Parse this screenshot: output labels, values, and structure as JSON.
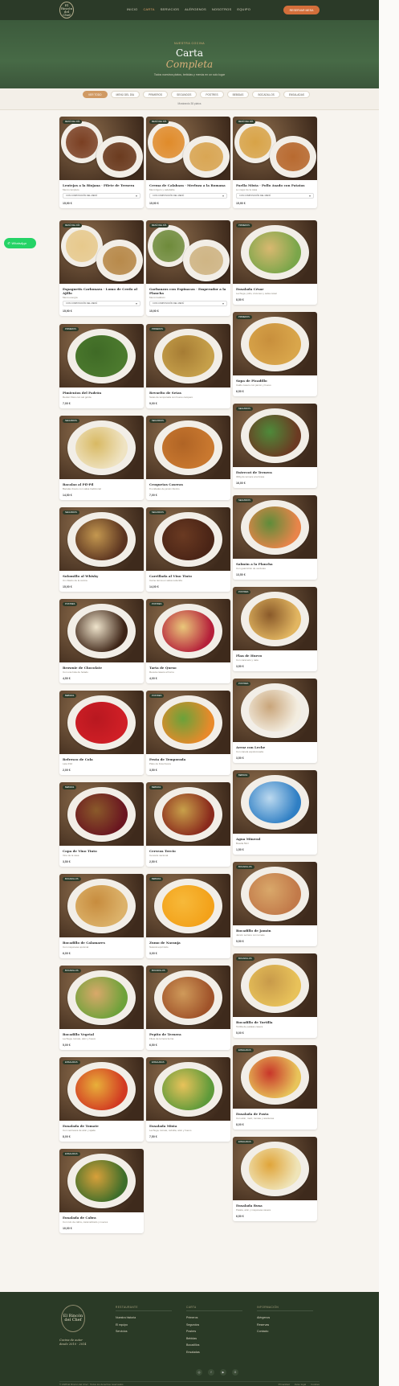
{
  "nav": {
    "logo_line1": "El Rincón",
    "logo_line2": "del Chef",
    "links": [
      "INICIO",
      "CARTA",
      "SERVICIOS",
      "ALÉRGENOS",
      "NOSOTROS",
      "EQUIPO"
    ],
    "active_link": "CARTA",
    "reserve_label": "RESERVAR MESA"
  },
  "hero": {
    "kicker": "NUESTRA COCINA",
    "title_line1": "Carta",
    "title_line2": "Completa",
    "subtitle": "Todos nuestros platos, bebidas y menús en un solo lugar"
  },
  "filters": {
    "chips": [
      "VER TODO",
      "MENÚ DEL DÍA",
      "PRIMEROS",
      "SEGUNDOS",
      "POSTRES",
      "BEBIDAS",
      "BOCADILLOS",
      "ENSALADAS"
    ],
    "active": "VER TODO",
    "count_text": "Mostrando 38 platos"
  },
  "whatsapp_label": "WhatsApp",
  "cards": [
    {
      "badge": "MENÚ DEL DÍA",
      "title": "Lentejas a la Riojana · Filete de Ternera",
      "desc": "Menú completo",
      "select": "CON COMPOSICIÓN DEL MENÚ",
      "price": "15,90 €",
      "colors": [
        "#7a3f22",
        "#6b3b1f"
      ]
    },
    {
      "badge": "MENÚ DEL DÍA",
      "title": "Crema de Calabaza · Merluza a la Romana",
      "desc": "Menú ligero y saludable",
      "select": "CON COMPOSICIÓN DEL MENÚ",
      "price": "15,90 €",
      "colors": [
        "#e08b2a",
        "#d9a654"
      ]
    },
    {
      "badge": "MENÚ DEL DÍA",
      "title": "Paella Mixta · Pollo Asado con Patatas",
      "desc": "Lo mejor de la casa",
      "select": "CON COMPOSICIÓN DEL MENÚ",
      "price": "15,90 €",
      "colors": [
        "#d8a347",
        "#b86a30"
      ]
    },
    {
      "badge": "MENÚ DEL DÍA",
      "title": "Espaguetis Carbonara · Lomo de Cerdo al Ajillo",
      "desc": "Menú energía",
      "select": "CON COMPOSICIÓN DEL MENÚ",
      "price": "15,90 €",
      "colors": [
        "#e7c98c",
        "#b88a4b"
      ]
    },
    {
      "badge": "MENÚ DEL DÍA",
      "title": "Garbanzos con Espinacas · Emperador a la Plancha",
      "desc": "Menú tradición",
      "select": "CON COMPOSICIÓN DEL MENÚ",
      "price": "15,90 €",
      "colors": [
        "#6e8a3a",
        "#cfb585"
      ]
    },
    {
      "badge": "PRIMEROS",
      "title": "Ensalada César",
      "desc": "Lechuga, pollo, crutones y salsa césar",
      "select": "",
      "price": "8,50 €",
      "colors": [
        "#7aa64a",
        "#d9b870"
      ]
    },
    {
      "badge": "PRIMEROS",
      "title": "Sopa de Picadillo",
      "desc": "Caldo casero con jamón y huevo",
      "select": "",
      "price": "6,50 €",
      "colors": [
        "#d9a64b",
        "#c88f3c"
      ]
    },
    {
      "badge": "PRIMEROS",
      "title": "Pimientos del Padrón",
      "desc": "Recién fritos con sal gorda",
      "select": "",
      "price": "7,00 €",
      "colors": [
        "#4c7a2e",
        "#3f6a26"
      ]
    },
    {
      "badge": "PRIMEROS",
      "title": "Revuelto de Setas",
      "desc": "Setas de temporada con huevo campero",
      "select": "",
      "price": "9,00 €",
      "colors": [
        "#c6a04a",
        "#a67c34"
      ]
    },
    {
      "badge": "SEGUNDOS",
      "title": "Entrecot de Ternera",
      "desc": "300g de ternera a la brasa",
      "select": "",
      "price": "16,00 €",
      "colors": [
        "#6b3a22",
        "#4e8a3a"
      ]
    },
    {
      "badge": "SEGUNDOS",
      "title": "Bacalao al Pil-Pil",
      "desc": "Bacalao fresco con salsa tradicional",
      "select": "",
      "price": "14,50 €",
      "colors": [
        "#efe3c2",
        "#d8b963"
      ]
    },
    {
      "badge": "SEGUNDOS",
      "title": "Croquetas Caseras",
      "desc": "8 unidades de jamón ibérico",
      "select": "",
      "price": "7,00 €",
      "colors": [
        "#c9782f",
        "#b06425"
      ]
    },
    {
      "badge": "SEGUNDOS",
      "title": "Salmón a la Plancha",
      "desc": "Con guarnición de verduras",
      "select": "",
      "price": "13,50 €",
      "colors": [
        "#e8854a",
        "#5e8c3a"
      ]
    },
    {
      "badge": "SEGUNDOS",
      "title": "Solomillo al Whisky",
      "desc": "Un clásico de la cocina",
      "select": "",
      "price": "15,00 €",
      "colors": [
        "#5b3420",
        "#c49850"
      ]
    },
    {
      "badge": "SEGUNDOS",
      "title": "Carrillada al Vino Tinto",
      "desc": "Carne tierna en salsa reducida",
      "select": "",
      "price": "14,00 €",
      "colors": [
        "#4a2416",
        "#6a3a22"
      ]
    },
    {
      "badge": "POSTRES",
      "title": "Flan de Huevo",
      "desc": "Con caramelo y nata",
      "select": "",
      "price": "3,50 €",
      "colors": [
        "#e2b661",
        "#8a5a2a"
      ]
    },
    {
      "badge": "POSTRES",
      "title": "Brownie de Chocolate",
      "desc": "Con una bola de helado",
      "select": "",
      "price": "4,50 €",
      "colors": [
        "#3d2416",
        "#efe4cc"
      ]
    },
    {
      "badge": "POSTRES",
      "title": "Tarta de Queso",
      "desc": "Receta casera al horno",
      "select": "",
      "price": "4,00 €",
      "colors": [
        "#b5203a",
        "#e9c77a"
      ]
    },
    {
      "badge": "POSTRES",
      "title": "Arroz con Leche",
      "desc": "Con canela espolvoreada",
      "select": "",
      "price": "3,50 €",
      "colors": [
        "#f3ede0",
        "#c9a57a"
      ]
    },
    {
      "badge": "BEBIDAS",
      "title": "Refresco de Cola",
      "desc": "Lata 33cl",
      "select": "",
      "price": "2,00 €",
      "colors": [
        "#d01f26",
        "#b81820"
      ]
    },
    {
      "badge": "POSTRES",
      "title": "Fruta de Temporada",
      "desc": "Plato de fruta fresca",
      "select": "",
      "price": "3,50 €",
      "colors": [
        "#e88a2a",
        "#6aa23a"
      ]
    },
    {
      "badge": "BEBIDAS",
      "title": "Agua Mineral",
      "desc": "Botella 50cl",
      "select": "",
      "price": "1,50 €",
      "colors": [
        "#2f7fc4",
        "#bcd9ef"
      ]
    },
    {
      "badge": "BEBIDAS",
      "title": "Copa de Vino Tinto",
      "desc": "Vino de la casa",
      "select": "",
      "price": "3,50 €",
      "colors": [
        "#6a1620",
        "#8a5a2a"
      ]
    },
    {
      "badge": "BEBIDAS",
      "title": "Cerveza Tercio",
      "desc": "Cerveza nacional",
      "select": "",
      "price": "2,50 €",
      "colors": [
        "#8a2a1c",
        "#c8a04a"
      ]
    },
    {
      "badge": "BOCADILLOS",
      "title": "Bocadillo de Jamón",
      "desc": "Jamón serrano con tomate",
      "select": "",
      "price": "5,50 €",
      "colors": [
        "#c27a4a",
        "#d9a86a"
      ]
    },
    {
      "badge": "BOCADILLOS",
      "title": "Bocadillo de Calamares",
      "desc": "Con mayonesa opcional",
      "select": "",
      "price": "6,00 €",
      "colors": [
        "#dcb26a",
        "#c78c3e"
      ]
    },
    {
      "badge": "BEBIDAS",
      "title": "Zumo de Naranja",
      "desc": "Natural exprimido",
      "select": "",
      "price": "3,00 €",
      "colors": [
        "#f3a21a",
        "#f7b93a"
      ]
    },
    {
      "badge": "BOCADILLOS",
      "title": "Bocadillo de Tortilla",
      "desc": "Tortilla de patatas casera",
      "select": "",
      "price": "5,00 €",
      "colors": [
        "#e8c25a",
        "#c89a4a"
      ]
    },
    {
      "badge": "BOCADILLOS",
      "title": "Bocadillo Vegetal",
      "desc": "Lechuga, tomate, atún y huevo",
      "select": "",
      "price": "5,00 €",
      "colors": [
        "#6ea23a",
        "#d9a86a"
      ]
    },
    {
      "badge": "BOCADILLOS",
      "title": "Pepito de Ternera",
      "desc": "Filete de ternera tierna",
      "select": "",
      "price": "6,50 €",
      "colors": [
        "#a0532a",
        "#cf9a5a"
      ]
    },
    {
      "badge": "ENSALADAS",
      "title": "Ensalada de Pasta",
      "desc": "Con atún, maíz, tomate y aceitunas",
      "select": "",
      "price": "8,00 €",
      "colors": [
        "#e8c45a",
        "#c8362a"
      ]
    },
    {
      "badge": "ENSALADAS",
      "title": "Ensalada de Tomate",
      "desc": "Con ventresca de atún y ajada",
      "select": "",
      "price": "8,00 €",
      "colors": [
        "#d23a22",
        "#e8b03a"
      ]
    },
    {
      "badge": "ENSALADAS",
      "title": "Ensalada Mixta",
      "desc": "Lechuga, tomate, cebolla, atún y huevo",
      "select": "",
      "price": "7,50 €",
      "colors": [
        "#5e9a3a",
        "#e8c25a"
      ]
    },
    {
      "badge": "ENSALADAS",
      "title": "Ensalada Rusa",
      "desc": "Patata, atún y mayonesa casera",
      "select": "",
      "price": "6,50 €",
      "colors": [
        "#efe4b8",
        "#e0a53a"
      ]
    },
    {
      "badge": "ENSALADAS",
      "title": "Ensalada de Cabra",
      "desc": "Con rulo de cabra, caramelizado y nueces",
      "select": "",
      "price": "10,00 €",
      "colors": [
        "#3e6e2a",
        "#d8a03a"
      ]
    }
  ],
  "footer": {
    "logo_line1": "El Rincón",
    "logo_line2": "del Chef",
    "tagline_1": "Cocina de autor",
    "tagline_2": "desde 2010 · 2014",
    "col1_heading": "RESTAURANTE",
    "col1_items": [
      "Nuestra historia",
      "El equipo",
      "Servicios"
    ],
    "col2_heading": "CARTA",
    "col2_items": [
      "Primeros",
      "Segundos",
      "Postres",
      "Bebidas",
      "Bocadillos",
      "Ensaladas"
    ],
    "col3_heading": "INFORMACIÓN",
    "col3_items": [
      "Alérgenos",
      "Reservas",
      "Contacto"
    ],
    "social": [
      "instagram-icon",
      "facebook-icon",
      "youtube-icon",
      "google-icon"
    ],
    "copyright": "© 2025 El Rincón del Chef · Todos los derechos reservados",
    "legal": [
      "Privacidad",
      "Aviso legal",
      "Cookies"
    ]
  }
}
